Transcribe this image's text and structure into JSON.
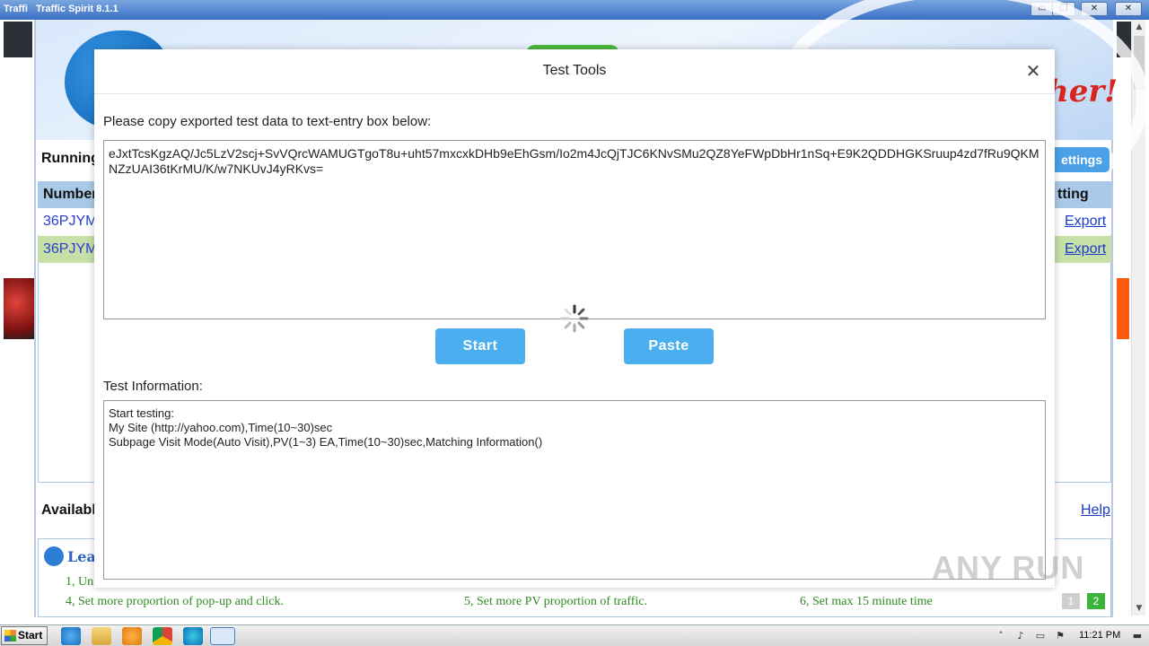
{
  "window": {
    "title": "Traffic Spirit 8.1.1",
    "title_stub": "Traffi",
    "controls": {
      "minimize": "▭",
      "restore": "❐",
      "close": "✕"
    }
  },
  "main": {
    "running_label": "Running",
    "settings_btn": "ettings",
    "table": {
      "head_left": "Number",
      "head_right": "tting",
      "rows": [
        {
          "number": "36PJYM",
          "action": "Export"
        },
        {
          "number": "36PJYM",
          "action": "Export"
        }
      ]
    },
    "available_label": "Availabl",
    "help_link": "Help",
    "learn": {
      "title": "Lea",
      "tips_row1_left": "1, Un",
      "tips": [
        "4, Set more proportion of pop-up and click.",
        "5, Set more PV proportion of traffic.",
        "6, Set max 15 minute time"
      ],
      "pages": [
        "1",
        "2"
      ]
    },
    "banner_text": "her!"
  },
  "modal": {
    "title": "Test Tools",
    "close_icon": "close-icon",
    "copy_label": "Please copy exported test data to text-entry box below:",
    "data_value": "eJxtTcsKgzAQ/Jc5LzV2scj+SvVQrcWAMUGTgoT8u+uht57mxcxkDHb9eEhGsm/Io2m4JcQjTJC6KNvSMu2QZ8YeFWpDbHr1nSq+E9K2QDDHGKSruup4zd7fRu9QKMNZzUAI36tKrMU/K/w7NKUvJ4yRKvs=",
    "start_btn": "Start",
    "paste_btn": "Paste",
    "info_label": "Test Information:",
    "info_lines": [
      "Start testing:",
      "My Site (http://yahoo.com),Time(10~30)sec",
      "Subpage Visit Mode(Auto Visit),PV(1~3) EA,Time(10~30)sec,Matching Information()"
    ]
  },
  "taskbar": {
    "start_label": "Start",
    "apps": [
      "ie-icon",
      "explorer-icon",
      "media-player-icon",
      "chrome-icon",
      "edge-icon",
      "traffic-spirit-icon"
    ],
    "clock": "11:21 PM"
  },
  "watermark": "ANY RUN"
}
